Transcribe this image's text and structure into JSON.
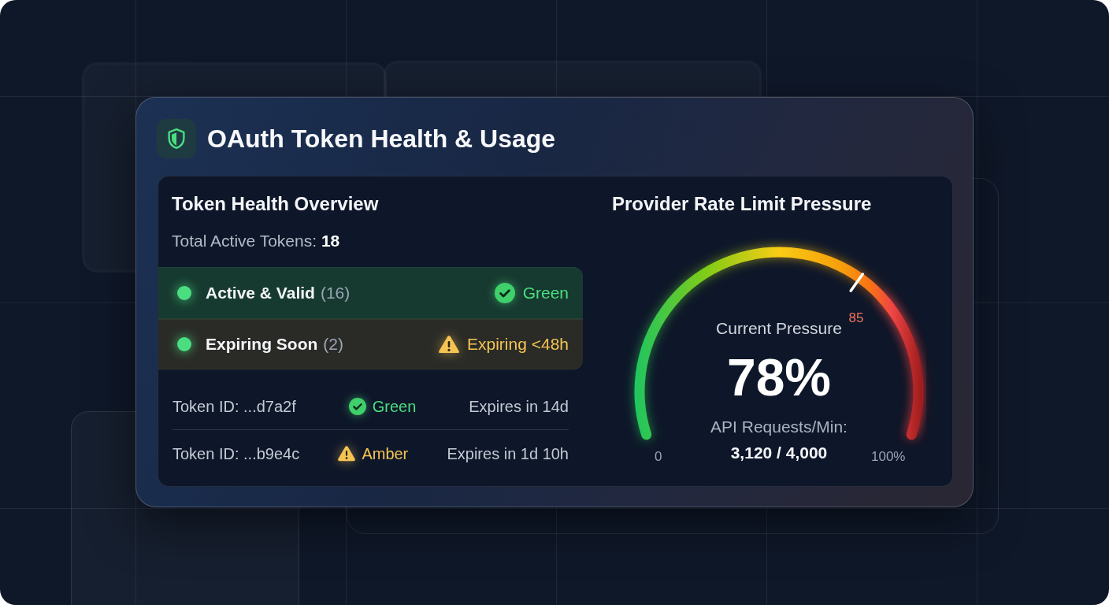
{
  "card": {
    "title": "OAuth Token Health & Usage"
  },
  "overview": {
    "heading": "Token Health Overview",
    "total": "Total Active Tokens: **18**",
    "summary": [
      {
        "kind": "ok",
        "label": "Active & Valid",
        "count": "(16)",
        "status": "Green"
      },
      {
        "kind": "warning",
        "label": "Expiring Soon",
        "count": "(2)",
        "status": "Expiring <48h"
      }
    ],
    "tokens": [
      {
        "kind": "ok",
        "id": "Token ID: ...d7a2f",
        "status": "Green",
        "expiry": "Expires in 14d"
      },
      {
        "kind": "warning",
        "id": "Token ID: ...b9e4c",
        "status": "Amber",
        "expiry": "Expires in 1d 10h"
      }
    ]
  },
  "pressure": {
    "heading": "Provider Rate Limit Pressure",
    "gauge": {
      "label": "Current Pressure",
      "value": "78%",
      "level": 0.78,
      "min_label": "0",
      "max_label": "100%",
      "threshold_label": "85",
      "caption": "API Requests/Min:",
      "reading": "3,120 / 4,000"
    }
  }
}
